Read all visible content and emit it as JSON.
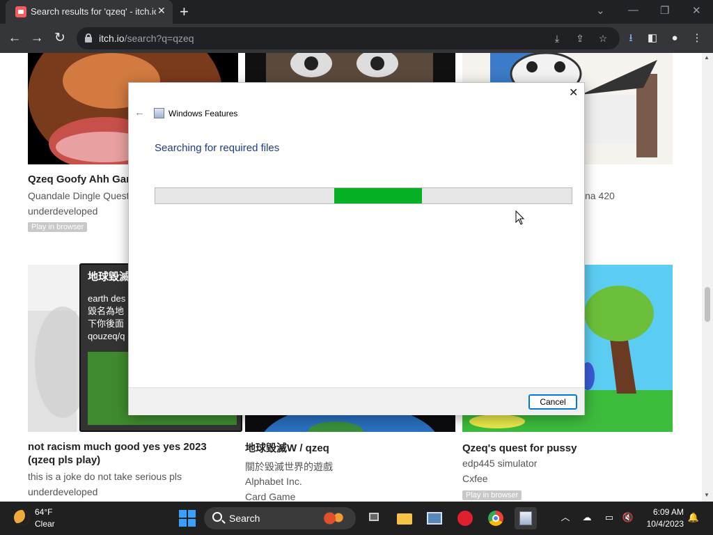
{
  "browser": {
    "tab_title": "Search results for 'qzeq' - itch.io",
    "url_host": "itch.io",
    "url_path": "/search?q=qzeq"
  },
  "games": {
    "row1": [
      {
        "title": "Qzeq Goofy Ahh Gar",
        "author": "Quandale Dingle Quest",
        "status": "underdeveloped",
        "tag": "Play in browser"
      },
      {
        "title": "",
        "author": "",
        "status": "",
        "tag": ""
      },
      {
        "title": "",
        "author": "na 420",
        "status": "",
        "tag": ""
      }
    ],
    "row2": [
      {
        "title": "not racism much good yes yes 2023 (qzeq pls play)",
        "subtitle": "this is a joke do not take serious pls",
        "status": "underdeveloped"
      },
      {
        "title": "地球毀滅W / qzeq",
        "subtitle": "關於毀滅世界的遊戲",
        "author": "Alphabet Inc.",
        "genre": "Card Game"
      },
      {
        "title": "Qzeq's quest for pussy",
        "subtitle": "edp445 simulator",
        "author": "Cxfee",
        "tag": "Play in browser"
      }
    ]
  },
  "card_popup": {
    "title": "地球毀滅",
    "lines": [
      "earth des",
      "毀名為地",
      "下你後面",
      "qouzeq/q"
    ]
  },
  "dialog": {
    "app_title": "Windows Features",
    "heading": "Searching for required files",
    "progress_start": 0.43,
    "progress_end": 0.64,
    "cancel_label": "Cancel"
  },
  "taskbar": {
    "temperature": "64°F",
    "condition": "Clear",
    "search_label": "Search",
    "time": "6:09 AM",
    "date": "10/4/2023"
  },
  "colors": {
    "progress": "#06b025",
    "dialog_heading": "#1e3a8a",
    "itch_accent": "#fa5c5c"
  }
}
